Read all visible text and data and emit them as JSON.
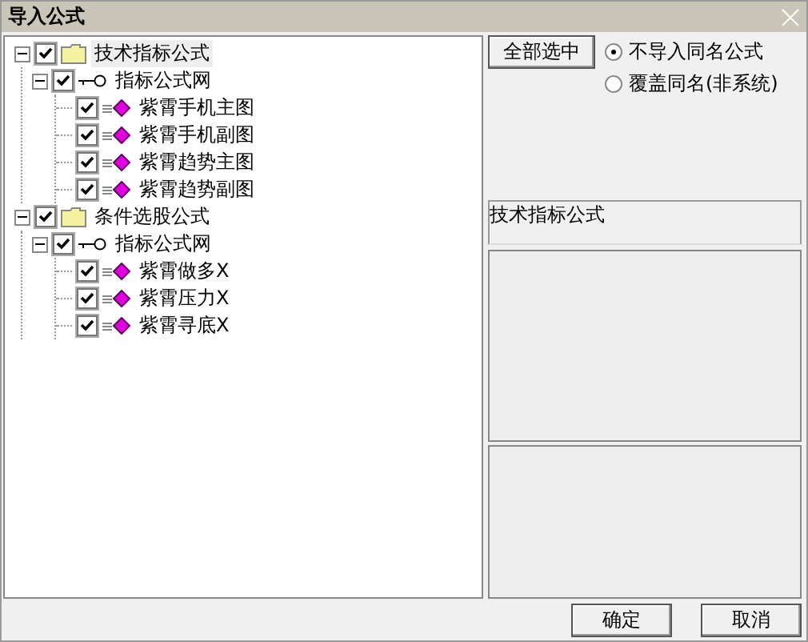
{
  "window": {
    "title": "导入公式"
  },
  "tree": [
    {
      "kind": "folder",
      "label": "技术指标公式",
      "checked": true,
      "expanded": true,
      "selected": true,
      "children": [
        {
          "kind": "group",
          "label": "指标公式网",
          "checked": true,
          "expanded": true,
          "selected": false,
          "children": [
            {
              "kind": "formula",
              "label": "紫霄手机主图",
              "checked": true,
              "selected": false
            },
            {
              "kind": "formula",
              "label": "紫霄手机副图",
              "checked": true,
              "selected": false
            },
            {
              "kind": "formula",
              "label": "紫霄趋势主图",
              "checked": true,
              "selected": false
            },
            {
              "kind": "formula",
              "label": "紫霄趋势副图",
              "checked": true,
              "selected": false
            }
          ]
        }
      ]
    },
    {
      "kind": "folder",
      "label": "条件选股公式",
      "checked": true,
      "expanded": true,
      "selected": false,
      "children": [
        {
          "kind": "group",
          "label": "指标公式网",
          "checked": true,
          "expanded": true,
          "selected": false,
          "children": [
            {
              "kind": "formula",
              "label": "紫霄做多X",
              "checked": true,
              "selected": false
            },
            {
              "kind": "formula",
              "label": "紫霄压力X",
              "checked": true,
              "selected": false
            },
            {
              "kind": "formula",
              "label": "紫霄寻底X",
              "checked": true,
              "selected": false
            }
          ]
        }
      ]
    }
  ],
  "select_all_button": "全部选中",
  "options": [
    {
      "label": "不导入同名公式",
      "selected": true
    },
    {
      "label": "覆盖同名(非系统)",
      "selected": false
    }
  ],
  "description": "技术指标公式",
  "buttons": [
    "确定",
    "取消"
  ]
}
